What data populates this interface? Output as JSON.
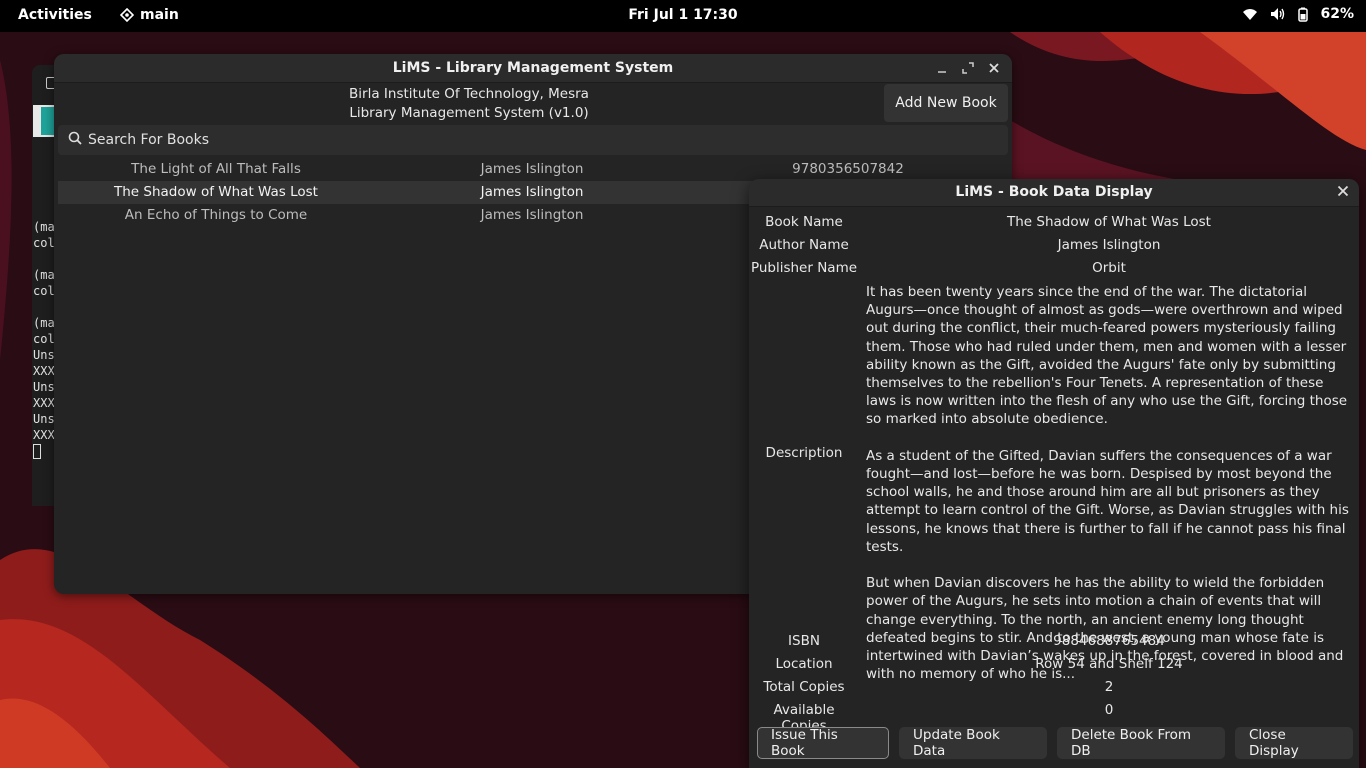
{
  "topbar": {
    "activities": "Activities",
    "workspace": "main",
    "clock": "Fri Jul 1  17:30",
    "battery": "62%"
  },
  "terminal": {
    "lines": [
      "(ma",
      "col",
      "",
      "(ma",
      "col",
      "",
      "(ma",
      "col",
      "Uns",
      "XXX",
      "Uns",
      "XXX",
      "Uns",
      "XXX"
    ]
  },
  "main_window": {
    "title": "LiMS - Library Management System",
    "institute_line1": "Birla Institute Of Technology, Mesra",
    "institute_line2": "Library Management System (v1.0)",
    "add_button": "Add New Book",
    "search_placeholder": "Search For Books",
    "books": [
      {
        "name": "The Light of All That Falls",
        "author": "James Islington",
        "isbn": "9780356507842"
      },
      {
        "name": "The Shadow of What Was Lost",
        "author": "James Islington",
        "isbn": ""
      },
      {
        "name": "An Echo of Things to Come",
        "author": "James Islington",
        "isbn": ""
      }
    ]
  },
  "dialog": {
    "title": "LiMS - Book Data Display",
    "labels": {
      "book_name": "Book Name",
      "author_name": "Author Name",
      "publisher_name": "Publisher Name",
      "description": "Description",
      "isbn": "ISBN",
      "location": "Location",
      "total_copies": "Total Copies",
      "available_copies": "Available Copies"
    },
    "values": {
      "book_name": "The Shadow of What Was Lost",
      "author_name": "James Islington",
      "publisher_name": "Orbit",
      "description_p1": "It has been twenty years since the end of the war. The dictatorial Augurs—once thought of almost as gods—were overthrown and wiped out during the conflict, their much-feared powers mysteriously failing them. Those who had ruled under them, men and women with a lesser ability known as the Gift, avoided the Augurs' fate only by submitting themselves to the rebellion's Four Tenets. A representation of these laws is now written into the flesh of any who use the Gift, forcing those so marked into absolute obedience.",
      "description_p2": "As a student of the Gifted, Davian suffers the consequences of a war fought—and lost—before he was born. Despised by most beyond the school walls, he and those around him are all but prisoners as they attempt to learn control of the Gift. Worse, as Davian struggles with his lessons, he knows that there is further to fall if he cannot pass his final tests.",
      "description_p3": "But when Davian discovers he has the ability to wield the forbidden power of the Augurs, he sets into motion a chain of events that will change everything. To the north, an ancient enemy long thought defeated begins to stir. And to the west, a young man whose fate is intertwined with Davian’s wakes up in the forest, covered in blood and with no memory of who he is...",
      "isbn": "9884688765484",
      "location": "Row 54 and Shelf 124",
      "total_copies": "2",
      "available_copies": "0"
    },
    "buttons": {
      "issue": "Issue This Book",
      "update": "Update Book Data",
      "delete": "Delete Book From DB",
      "close": "Close Display"
    }
  },
  "colors": {
    "wallpaper_dark": "#2a0c12",
    "wallpaper_red": "#b5231f",
    "window_bg": "#242424",
    "titlebar_bg": "#2b2b2b"
  }
}
